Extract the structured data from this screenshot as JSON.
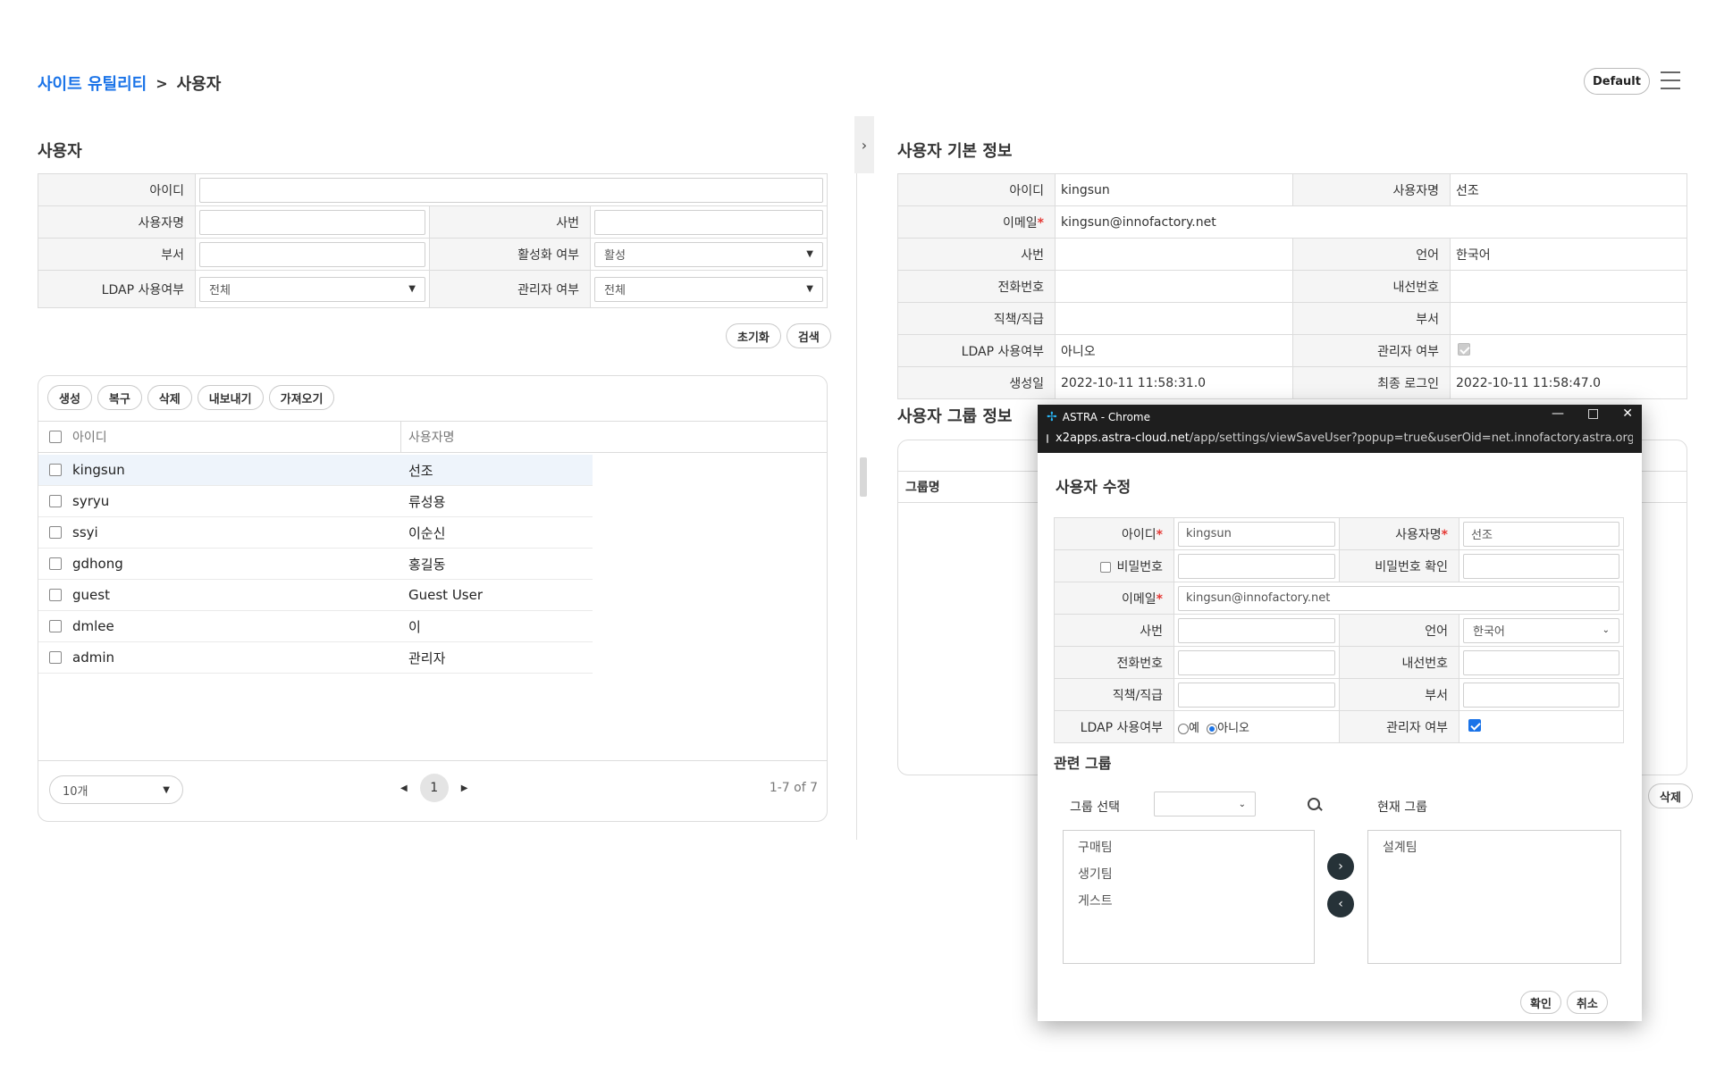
{
  "breadcrumb": {
    "parent": "사이트 유틸리티",
    "separator": ">",
    "current": "사용자"
  },
  "header": {
    "default_label": "Default"
  },
  "search": {
    "title": "사용자",
    "id_label": "아이디",
    "name_label": "사용자명",
    "empno_label": "사번",
    "dept_label": "부서",
    "active_label": "활성화 여부",
    "active_value": "활성",
    "ldap_label": "LDAP 사용여부",
    "ldap_value": "전체",
    "admin_label": "관리자 여부",
    "admin_value": "전체",
    "reset_label": "초기화",
    "search_label": "검색"
  },
  "list": {
    "toolbar": [
      "생성",
      "복구",
      "삭제",
      "내보내기",
      "가져오기"
    ],
    "columns": {
      "id": "아이디",
      "name": "사용자명"
    },
    "rows": [
      {
        "id": "kingsun",
        "name": "선조"
      },
      {
        "id": "syryu",
        "name": "류성용"
      },
      {
        "id": "ssyi",
        "name": "이순신"
      },
      {
        "id": "gdhong",
        "name": "홍길동"
      },
      {
        "id": "guest",
        "name": "Guest User"
      },
      {
        "id": "dmlee",
        "name": "이"
      },
      {
        "id": "admin",
        "name": "관리자"
      }
    ],
    "page_size": "10개",
    "page": "1",
    "range": "1-7 of 7"
  },
  "detail": {
    "title": "사용자 기본 정보",
    "id_label": "아이디",
    "id_value": "kingsun",
    "name_label": "사용자명",
    "name_value": "선조",
    "email_label": "이메일",
    "email_value": "kingsun@innofactory.net",
    "empno_label": "사번",
    "lang_label": "언어",
    "lang_value": "한국어",
    "phone_label": "전화번호",
    "ext_label": "내선번호",
    "position_label": "직책/직급",
    "dept_label": "부서",
    "ldap_label": "LDAP 사용여부",
    "ldap_value": "아니오",
    "admin_label": "관리자 여부",
    "created_label": "생성일",
    "created_value": "2022-10-11 11:58:31.0",
    "lastlogin_label": "최종 로그인",
    "lastlogin_value": "2022-10-11 11:58:47.0"
  },
  "group_info": {
    "title": "사용자 그룹 정보",
    "column": "그룹명",
    "delete_label": "삭제"
  },
  "popup": {
    "window_title": "ASTRA - Chrome",
    "url_host": "x2apps.astra-cloud.net",
    "url_path": "/app/settings/viewSaveUser?popup=true&userOid=net.innofactory.astra.org.U...",
    "heading": "사용자 수정",
    "id_label": "아이디",
    "id_value": "kingsun",
    "name_label": "사용자명",
    "name_value": "선조",
    "password_label": "비밀번호",
    "password_confirm_label": "비밀번호 확인",
    "email_label": "이메일",
    "email_value": "kingsun@innofactory.net",
    "empno_label": "사번",
    "lang_label": "언어",
    "lang_value": "한국어",
    "phone_label": "전화번호",
    "ext_label": "내선번호",
    "position_label": "직책/직급",
    "dept_label": "부서",
    "ldap_label": "LDAP 사용여부",
    "ldap_yes": "예",
    "ldap_no": "아니오",
    "admin_label": "관리자 여부",
    "related_group_title": "관련 그룹",
    "group_select_label": "그룹 선택",
    "current_group_label": "현재 그룹",
    "available_groups": [
      "구매팀",
      "생기팀",
      "게스트"
    ],
    "current_groups": [
      "설계팀"
    ],
    "confirm_label": "확인",
    "cancel_label": "취소",
    "required_mark": "*"
  }
}
